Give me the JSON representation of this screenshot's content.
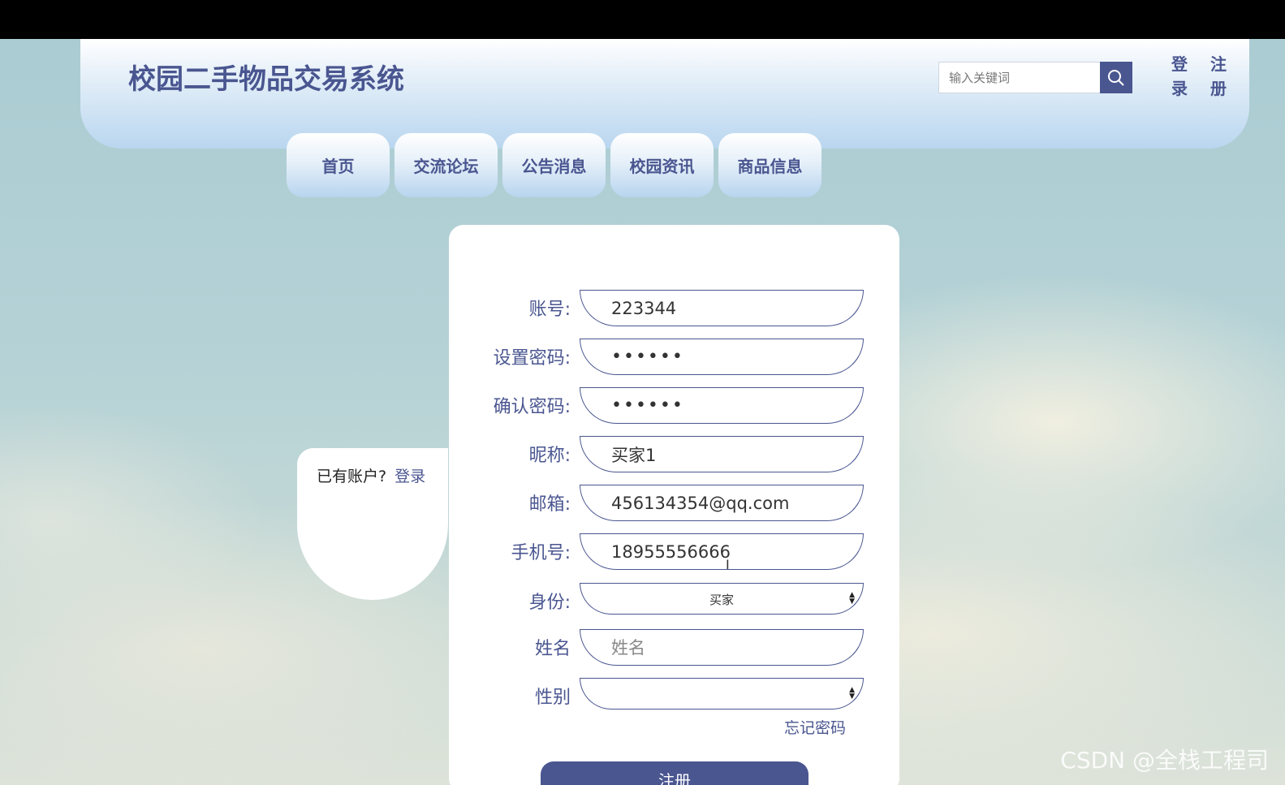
{
  "header": {
    "title": "校园二手物品交易系统",
    "search_placeholder": "输入关键词",
    "login_label": "登录",
    "register_label": "注册"
  },
  "nav": {
    "items": [
      {
        "label": "首页"
      },
      {
        "label": "交流论坛"
      },
      {
        "label": "公告消息"
      },
      {
        "label": "校园资讯"
      },
      {
        "label": "商品信息"
      }
    ]
  },
  "side": {
    "has_account": "已有账户?",
    "login_link": "登录"
  },
  "form": {
    "account": {
      "label": "账号:",
      "value": "223344"
    },
    "password": {
      "label": "设置密码:",
      "value": "••••••"
    },
    "confirm_password": {
      "label": "确认密码:",
      "value": "••••••"
    },
    "nickname": {
      "label": "昵称:",
      "value": "买家1"
    },
    "email": {
      "label": "邮箱:",
      "value": "456134354@qq.com"
    },
    "phone": {
      "label": "手机号:",
      "value": "18955556666"
    },
    "identity": {
      "label": "身份:",
      "value": "买家"
    },
    "name": {
      "label": "姓名",
      "placeholder": "姓名"
    },
    "gender": {
      "label": "性别",
      "value": ""
    },
    "forgot_password": "忘记密码",
    "submit_label": "注册"
  },
  "watermark": "CSDN @全栈工程司",
  "colors": {
    "primary": "#4a5690",
    "header_gradient_end": "#b9d6ef"
  }
}
